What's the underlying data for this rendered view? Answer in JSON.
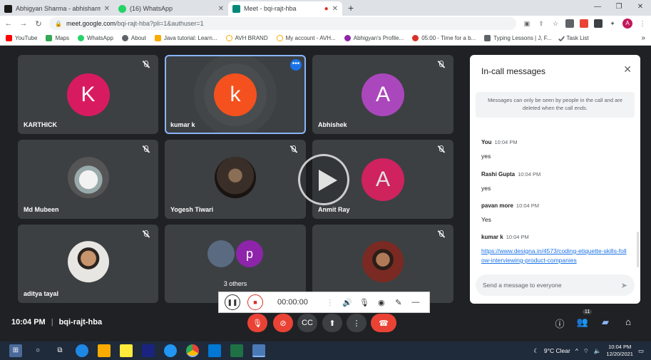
{
  "browser": {
    "tabs": [
      {
        "title": "Abhigyan Sharma - abhisharmaa",
        "color": "#1a1a1a",
        "active": false
      },
      {
        "title": "(16) WhatsApp",
        "color": "#25d366",
        "active": false
      },
      {
        "title": "Meet - bqi-rajt-hba",
        "color": "#00897b",
        "active": true
      }
    ],
    "url_host": "meet.google.com",
    "url_path": "/bqi-rajt-hba?pli=1&authuser=1",
    "profile_initial": "A",
    "bookmarks": [
      {
        "label": "YouTube",
        "color": "#ff0000"
      },
      {
        "label": "Maps",
        "color": "#34a853"
      },
      {
        "label": "WhatsApp",
        "color": "#25d366"
      },
      {
        "label": "About",
        "color": "#5f6368"
      },
      {
        "label": "Java tutorial: Learn...",
        "color": "#f9ab00"
      },
      {
        "label": "AVH BRAND",
        "color": "#f9ab00"
      },
      {
        "label": "My account - AVH...",
        "color": "#f9ab00"
      },
      {
        "label": "Abhigyan's Profile...",
        "color": "#8e24aa"
      },
      {
        "label": "05:00 - Time for a b...",
        "color": "#d93025"
      },
      {
        "label": "Typing Lessons | J, F...",
        "color": "#5f6368"
      },
      {
        "label": "Task List",
        "color": "#5f6368"
      }
    ]
  },
  "meet": {
    "participants": [
      {
        "name": "KARTHICK",
        "initial": "K",
        "color": "#d81b60"
      },
      {
        "name": "kumar k",
        "initial": "k",
        "color": "#f4511e"
      },
      {
        "name": "Abhishek",
        "initial": "A",
        "color": "#ab47bc"
      },
      {
        "name": "Md Mubeen"
      },
      {
        "name": "Yogesh Tiwari"
      },
      {
        "name": "Anmit Ray",
        "initial": "A",
        "color": "#e91e63"
      },
      {
        "name": "aditya tayal"
      },
      {
        "name": "3 others",
        "initial": "p"
      },
      {
        "name": ""
      }
    ],
    "time": "10:04 PM",
    "meeting_code": "bqi-rajt-hba",
    "people_count": "11"
  },
  "recorder": {
    "time": "00:00:00"
  },
  "chat": {
    "title": "In-call messages",
    "notice": "Messages can only be seen by people in the call and are deleted when the call ends.",
    "messages": [
      {
        "sender": "You",
        "time": "10:04 PM",
        "text": "yes"
      },
      {
        "sender": "Rashi Gupta",
        "time": "10:04 PM",
        "text": "yes"
      },
      {
        "sender": "pavan more",
        "time": "10:04 PM",
        "text": "Yes"
      },
      {
        "sender": "kumar k",
        "time": "10:04 PM",
        "text": "https://www.designa.in/4573/coding-etiquette-skills-follow-interviewing-product-companies"
      }
    ],
    "input_placeholder": "Send a message to everyone"
  },
  "taskbar": {
    "weather": "9°C  Clear",
    "time": "10:04 PM",
    "date": "12/20/2021"
  }
}
